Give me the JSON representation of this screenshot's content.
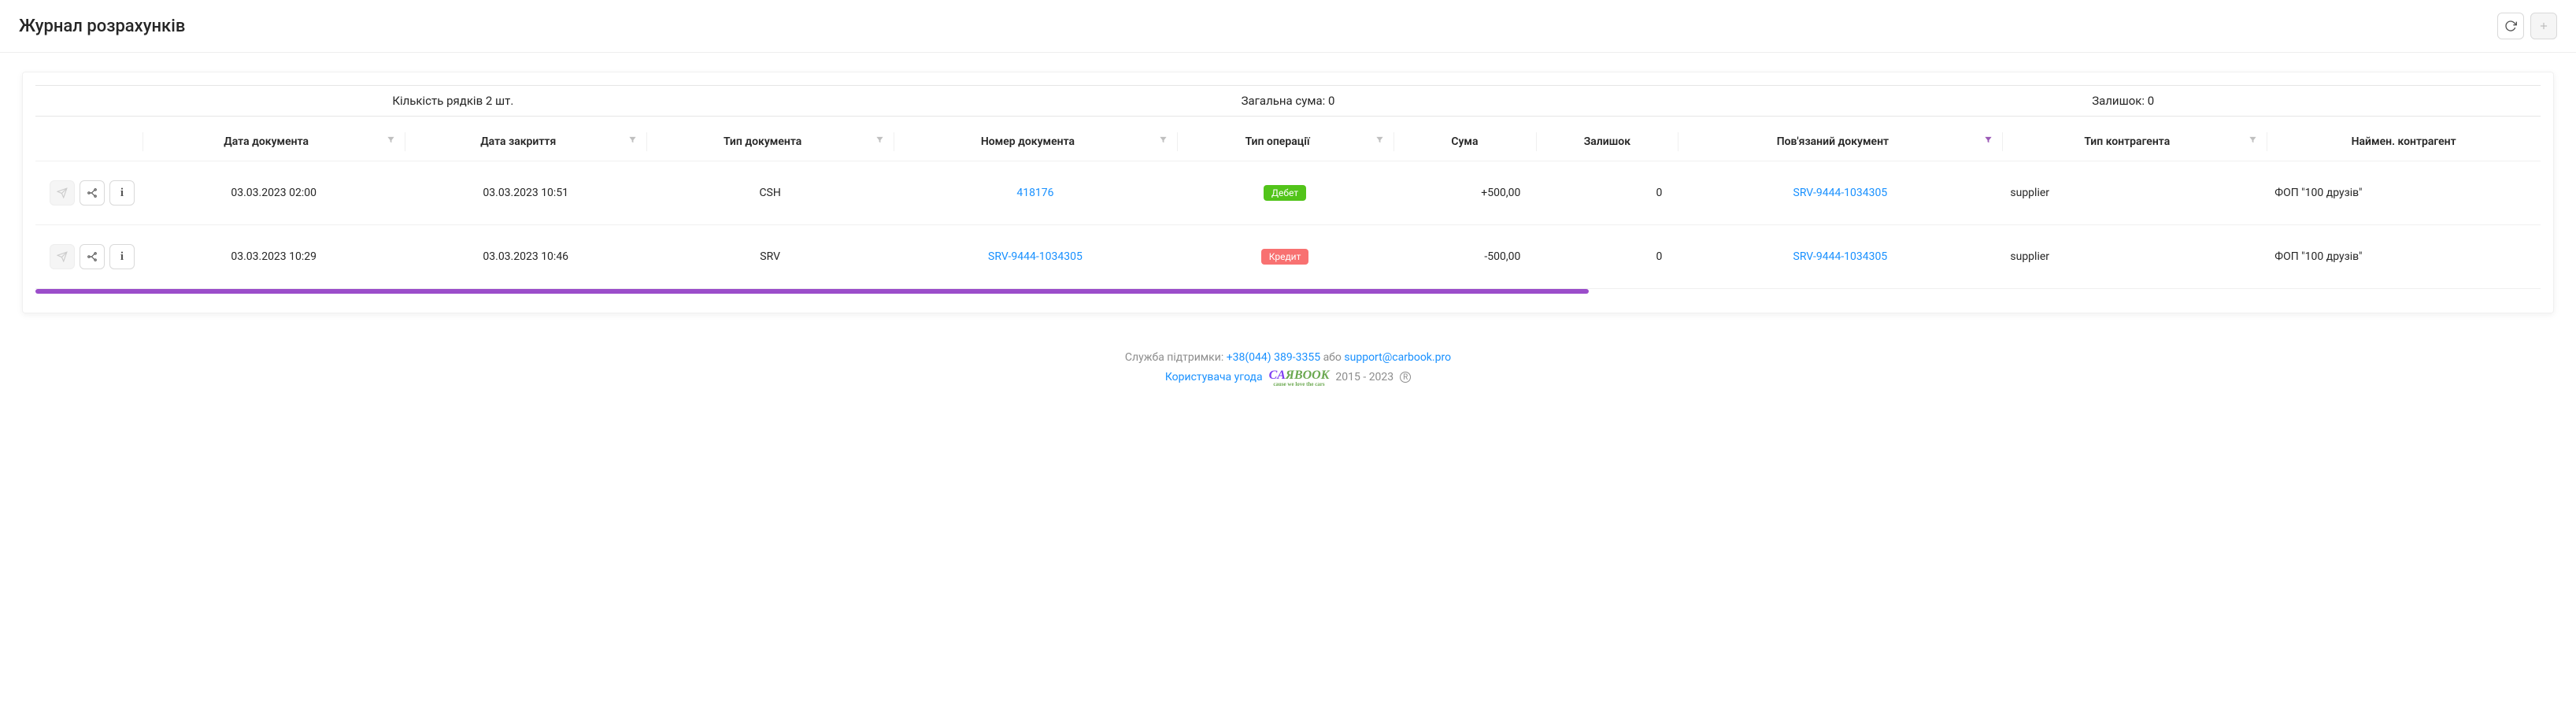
{
  "header": {
    "title": "Журнал розрахунків"
  },
  "summary": {
    "row_count": "Кількість рядків 2 шт.",
    "total_sum": "Загальна сума: 0",
    "balance": "Залишок: 0"
  },
  "columns": {
    "doc_date": "Дата документа",
    "close_date": "Дата закриття",
    "doc_type": "Тип документа",
    "doc_number": "Номер документа",
    "op_type": "Тип операції",
    "sum": "Сума",
    "balance": "Залишок",
    "related_doc": "Пов'язаний документ",
    "counterparty_type": "Тип контрагента",
    "counterparty_name": "Наймен. контрагент"
  },
  "rows": [
    {
      "doc_date": "03.03.2023 02:00",
      "close_date": "03.03.2023 10:51",
      "doc_type": "CSH",
      "doc_number": "418176",
      "op_type": "Дебет",
      "op_type_color": "green",
      "sum": "+500,00",
      "balance": "0",
      "related_doc": "SRV-9444-1034305",
      "counterparty_type": "supplier",
      "counterparty_name": "ФОП \"100 друзів\""
    },
    {
      "doc_date": "03.03.2023 10:29",
      "close_date": "03.03.2023 10:46",
      "doc_type": "SRV",
      "doc_number": "SRV-9444-1034305",
      "op_type": "Кредит",
      "op_type_color": "red",
      "sum": "-500,00",
      "balance": "0",
      "related_doc": "SRV-9444-1034305",
      "counterparty_type": "supplier",
      "counterparty_name": "ФОП \"100 друзів\""
    }
  ],
  "footer": {
    "support_label": "Служба підтримки:",
    "phone": "+38(044) 389-3355",
    "or": "або",
    "email": "support@carbook.pro",
    "agreement": "Користувача угода",
    "years": "2015 - 2023"
  }
}
